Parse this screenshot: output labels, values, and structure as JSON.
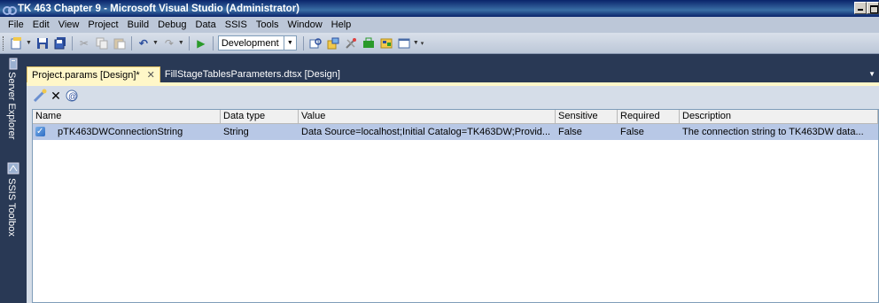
{
  "window": {
    "title": "TK 463 Chapter 9 - Microsoft Visual Studio (Administrator)"
  },
  "menu": [
    {
      "label": "File"
    },
    {
      "label": "Edit"
    },
    {
      "label": "View"
    },
    {
      "label": "Project"
    },
    {
      "label": "Build"
    },
    {
      "label": "Debug"
    },
    {
      "label": "Data"
    },
    {
      "label": "SSIS"
    },
    {
      "label": "Tools"
    },
    {
      "label": "Window"
    },
    {
      "label": "Help"
    }
  ],
  "toolbar": {
    "configuration": "Development"
  },
  "sidebar": {
    "tabs": [
      "Server Explorer",
      "SSIS Toolbox"
    ]
  },
  "tabs": [
    {
      "label": "Project.params [Design]*"
    },
    {
      "label": "FillStageTablesParameters.dtsx [Design]"
    }
  ],
  "grid": {
    "columns": [
      "Name",
      "Data type",
      "Value",
      "Sensitive",
      "Required",
      "Description"
    ],
    "rows": [
      {
        "name": "pTK463DWConnectionString",
        "type": "String",
        "value": "Data Source=localhost;Initial Catalog=TK463DW;Provid...",
        "sensitive": "False",
        "required": "False",
        "description": "The connection string to TK463DW data..."
      }
    ]
  },
  "icons": {
    "panel_toolbar": [
      "add-parameter-icon",
      "delete-parameter-icon",
      "add-to-config-icon"
    ]
  },
  "colors": {
    "selected_row": "#b8c8e6",
    "active_tab": "#fff7c8",
    "chrome": "#293955"
  }
}
